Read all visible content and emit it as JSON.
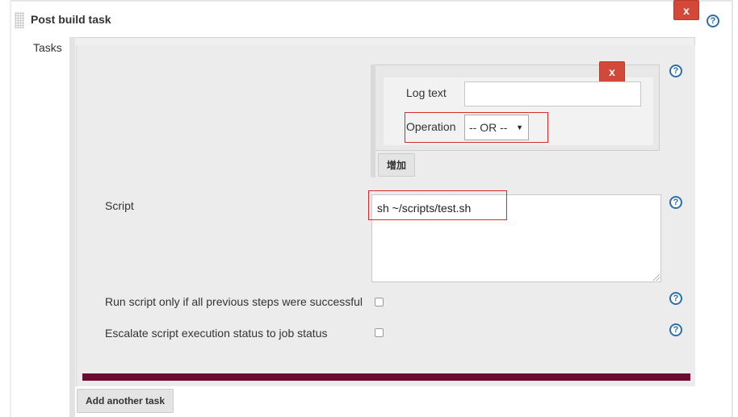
{
  "section": {
    "title": "Post build task",
    "delete_label": "x",
    "help_label": "?"
  },
  "tasks": {
    "label": "Tasks",
    "log_entry": {
      "delete_label": "x",
      "log_text_label": "Log text",
      "log_text_value": "",
      "operation_label": "Operation",
      "operation_value": "-- OR --",
      "help_label": "?"
    },
    "add_button_label": "增加",
    "script": {
      "label": "Script",
      "value": "sh ~/scripts/test.sh",
      "help_label": "?"
    },
    "run_only_if_success": {
      "label": "Run script only if all previous steps were successful",
      "checked": false,
      "help_label": "?"
    },
    "escalate_status": {
      "label": "Escalate script execution status to job status",
      "checked": false,
      "help_label": "?"
    },
    "add_another_task_label": "Add another task"
  },
  "colors": {
    "delete_button": "#d24939",
    "help_icon": "#2d6fa8",
    "highlight_outline": "#d62b2b",
    "divider_bar": "#6d0a32"
  }
}
